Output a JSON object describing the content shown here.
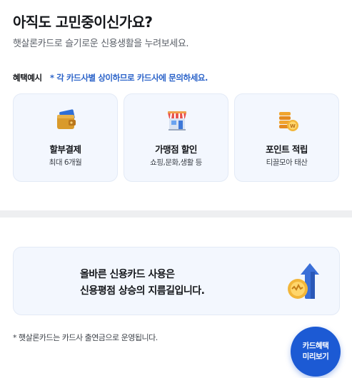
{
  "header": {
    "title": "아직도 고민중이신가요?",
    "subtitle": "햇살론카드로 슬기로운 신용생활을 누려보세요."
  },
  "benefits": {
    "label": "혜택예시",
    "note": "* 각 카드사별 상이하므로 카드사에 문의하세요.",
    "cards": [
      {
        "icon": "wallet-icon",
        "title": "할부결제",
        "desc": "최대 6개월"
      },
      {
        "icon": "store-icon",
        "title": "가맹점 할인",
        "desc": "쇼핑,문화,생활 등"
      },
      {
        "icon": "coins-icon",
        "title": "포인트 적립",
        "desc": "티끌모아 태산"
      }
    ]
  },
  "banner": {
    "line1": "올바른 신용카드 사용은",
    "line2": "신용평점 상승의 지름길입니다.",
    "icon": "credit-score-up-icon"
  },
  "footnote": "* 햇살론카드는 카드사 출연금으로 운영됩니다.",
  "fab": {
    "line1": "카드혜택",
    "line2": "미리보기"
  },
  "colors": {
    "accent": "#1c5ad4",
    "note_blue": "#2b63c9",
    "card_bg": "#f3f7fe",
    "divider": "#eeeff1"
  }
}
